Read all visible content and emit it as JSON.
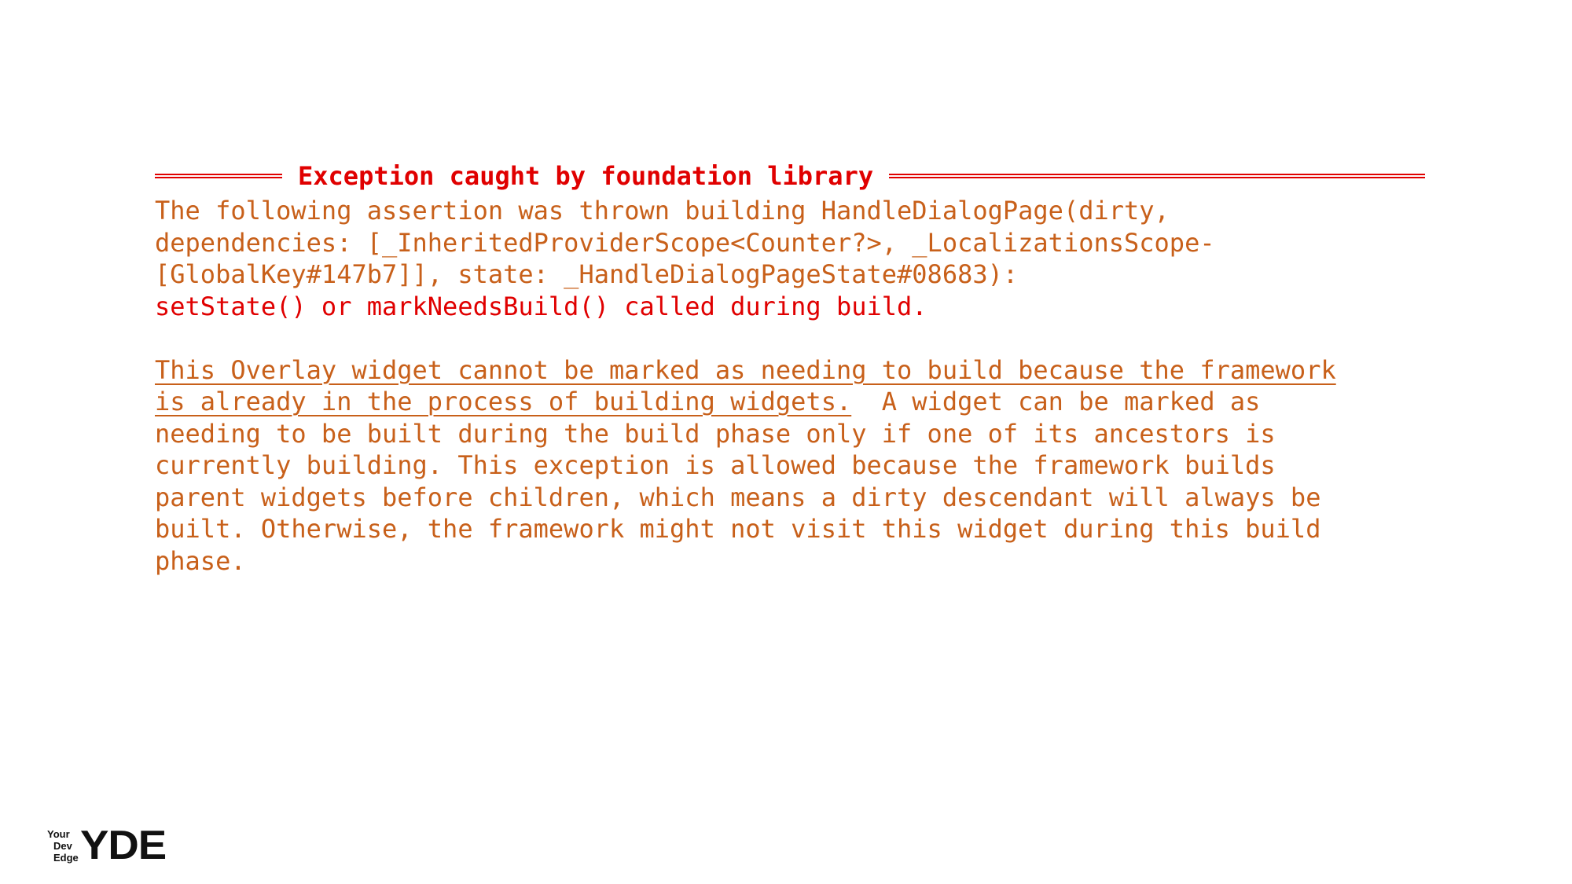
{
  "header": {
    "title": "Exception caught by foundation library"
  },
  "body": {
    "assertion_lines": [
      "The following assertion was thrown building HandleDialogPage(dirty,",
      "dependencies: [_InheritedProviderScope<Counter?>, _LocalizationsScope-",
      "[GlobalKey#147b7]], state: _HandleDialogPageState#08683):"
    ],
    "error_line": "setState() or markNeedsBuild() called during build.",
    "underlined_line_1": "This Overlay widget cannot be marked as needing to build because the framework",
    "underlined_line_2": "is already in the process of building widgets.",
    "line_2_rest": "  A widget can be marked as",
    "detail_lines": [
      "needing to be built during the build phase only if one of its ancestors is",
      "currently building. This exception is allowed because the framework builds",
      "parent widgets before children, which means a dirty descendant will always be",
      "built. Otherwise, the framework might not visit this widget during this build",
      "phase."
    ]
  },
  "logo": {
    "small_lines": [
      "Your",
      "Dev",
      "Edge"
    ],
    "big_text": "YDE"
  },
  "colors": {
    "error_red": "#e00000",
    "assertion_orange": "#c8601a"
  }
}
